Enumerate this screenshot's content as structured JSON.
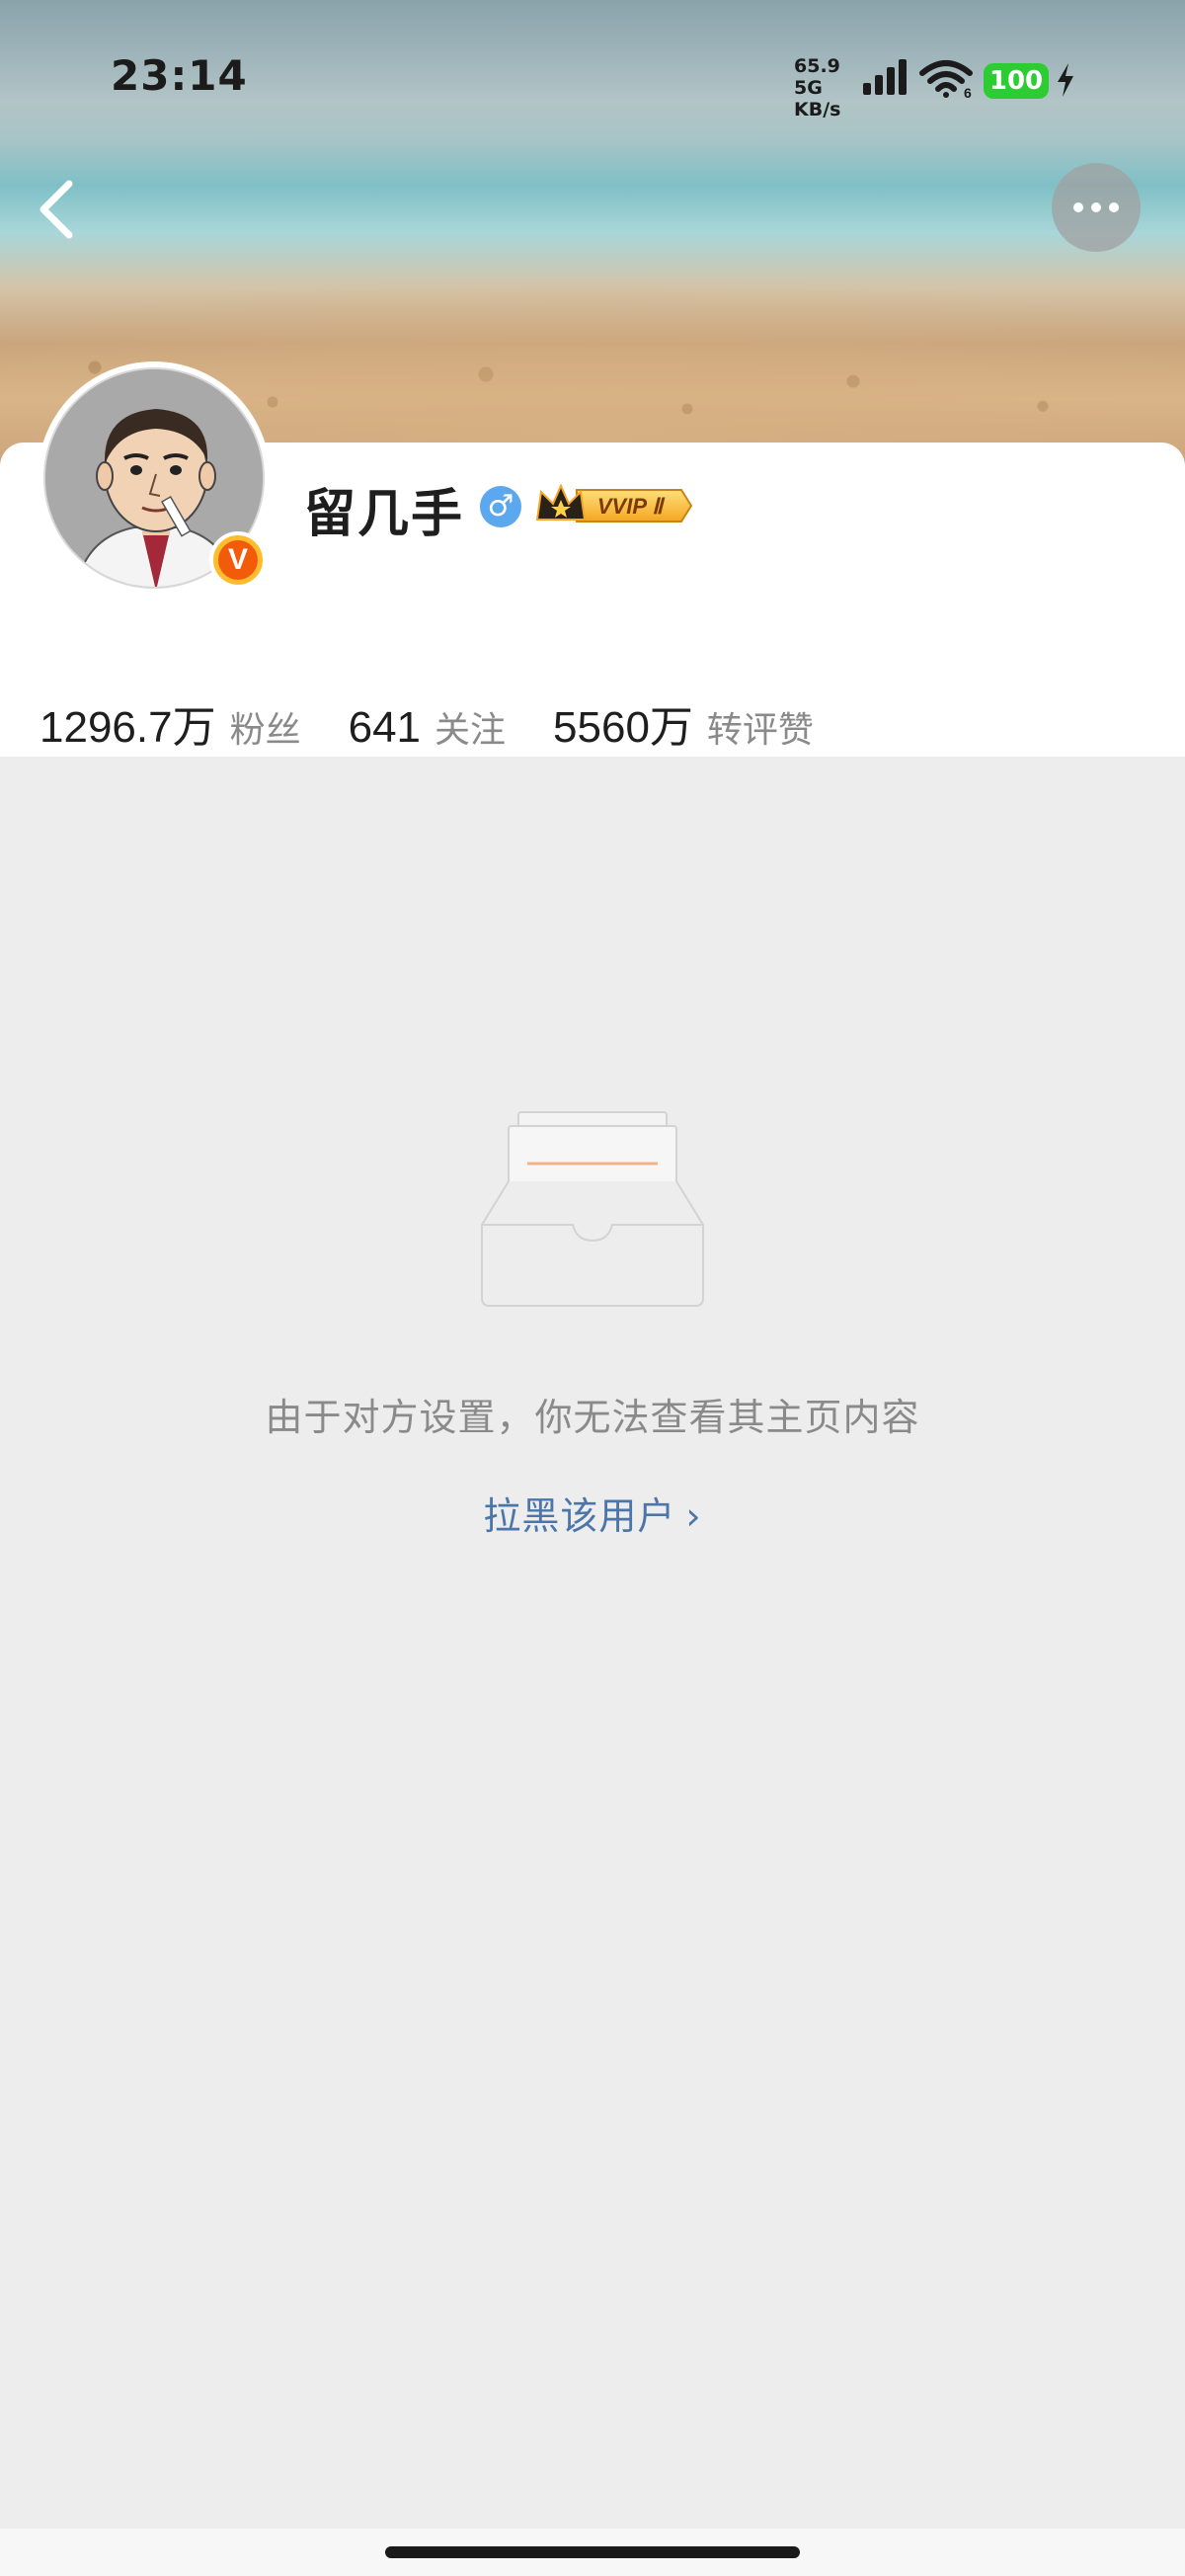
{
  "status_bar": {
    "time": "23:14",
    "net_speed_value": "65.9",
    "net_speed_unit": "KB/s",
    "network_type": "5G",
    "wifi_label": "6",
    "battery": "100"
  },
  "profile": {
    "name": "留几手",
    "verified_mark": "V",
    "gender_symbol": "♂",
    "vip_badge": "VVIP Ⅱ"
  },
  "stats": [
    {
      "value": "1296.7万",
      "label": "粉丝"
    },
    {
      "value": "641",
      "label": "关注"
    },
    {
      "value": "5560万",
      "label": "转评赞"
    }
  ],
  "empty_state": {
    "message": "由于对方设置，你无法查看其主页内容",
    "action": "拉黑该用户",
    "action_chevron": "›"
  },
  "colors": {
    "accent_link": "#4d76a8",
    "battery_green": "#2ecc33",
    "gender_blue": "#5ba8ee",
    "verified_orange": "#f25b0a"
  },
  "icons": {
    "back": "back-arrow-icon",
    "more": "more-dots-icon",
    "empty": "empty-inbox-icon"
  }
}
